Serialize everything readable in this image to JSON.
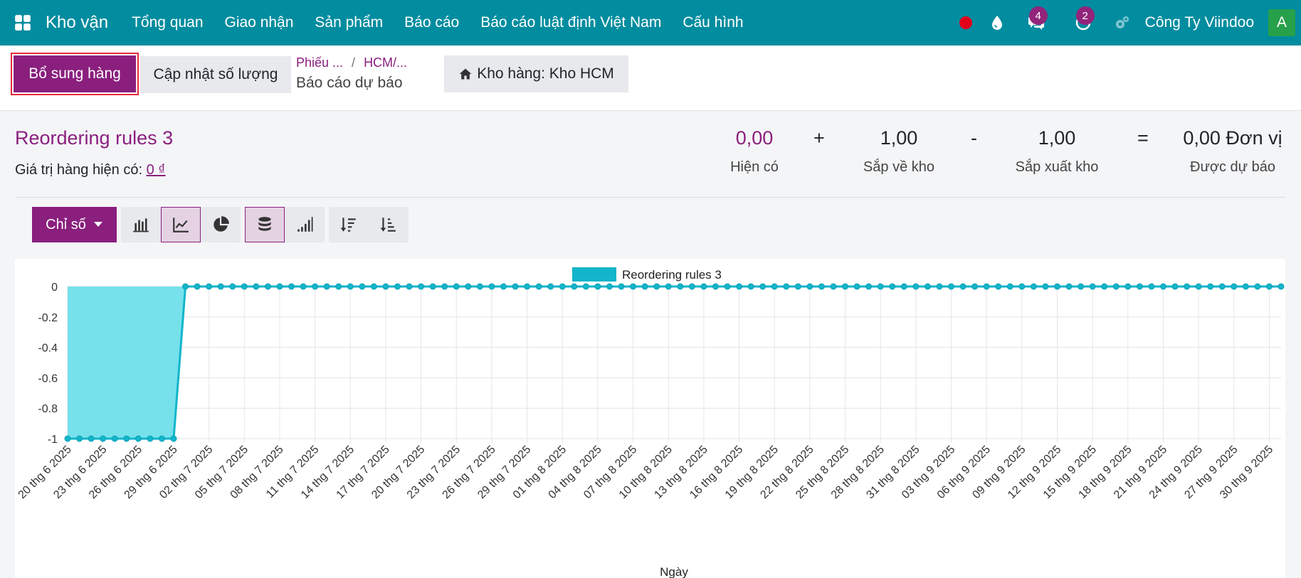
{
  "navbar": {
    "app_name": "Kho vận",
    "menu": [
      "Tổng quan",
      "Giao nhận",
      "Sản phẩm",
      "Báo cáo",
      "Báo cáo luật định Việt Nam",
      "Cấu hình"
    ],
    "messages_count": "4",
    "activities_count": "2",
    "company": "Công Ty Viindoo",
    "avatar_letter": "A"
  },
  "control": {
    "replenish_label": "Bổ sung hàng",
    "update_qty_label": "Cập nhật số lượng",
    "breadcrumb": [
      "Phiếu ...",
      "HCM/..."
    ],
    "current_page": "Báo cáo dự báo",
    "warehouse_label": "Kho hàng: Kho HCM"
  },
  "summary": {
    "product": "Reordering rules 3",
    "value_label": "Giá trị hàng hiện có: ",
    "value_amount": "0 ₫",
    "on_hand": {
      "value": "0,00",
      "label": "Hiện có"
    },
    "op_plus": "+",
    "incoming": {
      "value": "1,00",
      "label": "Sắp về kho"
    },
    "op_minus": "-",
    "outgoing": {
      "value": "1,00",
      "label": "Sắp xuất kho"
    },
    "op_equal": "=",
    "forecast": {
      "value": "0,00 Đơn vị",
      "label": "Được dự báo"
    }
  },
  "toolbar": {
    "measure_label": "Chỉ số",
    "icons": [
      "bar-chart-icon",
      "line-chart-icon",
      "pie-chart-icon",
      "stacked-icon",
      "cumulative-icon",
      "sort-desc-icon",
      "sort-asc-icon"
    ]
  },
  "colors": {
    "navbar": "#018c9f",
    "primary": "#8a1f7e",
    "series": "#12b5cb",
    "series_fill": "#6fdfea"
  },
  "chart_data": {
    "type": "area",
    "x_start_date": "2025-06-20",
    "x_points": 104,
    "series": [
      {
        "name": "Reordering rules 3",
        "values": [
          -1,
          -1,
          -1,
          -1,
          -1,
          -1,
          -1,
          -1,
          -1,
          -1,
          0,
          0,
          0,
          0,
          0,
          0,
          0,
          0,
          0,
          0,
          0,
          0,
          0,
          0,
          0,
          0,
          0,
          0,
          0,
          0,
          0,
          0,
          0,
          0,
          0,
          0,
          0,
          0,
          0,
          0,
          0,
          0,
          0,
          0,
          0,
          0,
          0,
          0,
          0,
          0,
          0,
          0,
          0,
          0,
          0,
          0,
          0,
          0,
          0,
          0,
          0,
          0,
          0,
          0,
          0,
          0,
          0,
          0,
          0,
          0,
          0,
          0,
          0,
          0,
          0,
          0,
          0,
          0,
          0,
          0,
          0,
          0,
          0,
          0,
          0,
          0,
          0,
          0,
          0,
          0,
          0,
          0,
          0,
          0,
          0,
          0,
          0,
          0,
          0,
          0,
          0,
          0,
          0,
          0
        ]
      }
    ],
    "x_tick_labels": [
      "20 thg 6 2025",
      "23 thg 6 2025",
      "26 thg 6 2025",
      "29 thg 6 2025",
      "02 thg 7 2025",
      "05 thg 7 2025",
      "08 thg 7 2025",
      "11 thg 7 2025",
      "14 thg 7 2025",
      "17 thg 7 2025",
      "20 thg 7 2025",
      "23 thg 7 2025",
      "26 thg 7 2025",
      "29 thg 7 2025",
      "01 thg 8 2025",
      "04 thg 8 2025",
      "07 thg 8 2025",
      "10 thg 8 2025",
      "13 thg 8 2025",
      "16 thg 8 2025",
      "19 thg 8 2025",
      "22 thg 8 2025",
      "25 thg 8 2025",
      "28 thg 8 2025",
      "31 thg 8 2025",
      "03 thg 9 2025",
      "06 thg 9 2025",
      "09 thg 9 2025",
      "12 thg 9 2025",
      "15 thg 9 2025",
      "18 thg 9 2025",
      "21 thg 9 2025",
      "24 thg 9 2025",
      "27 thg 9 2025",
      "30 thg 9 2025"
    ],
    "y_ticks": [
      "0",
      "-0.2",
      "-0.4",
      "-0.6",
      "-0.8",
      "-1"
    ],
    "ylim": [
      -1,
      0
    ],
    "xlabel": "Ngày",
    "ylabel": "",
    "legend": "top-center",
    "grid": true
  }
}
